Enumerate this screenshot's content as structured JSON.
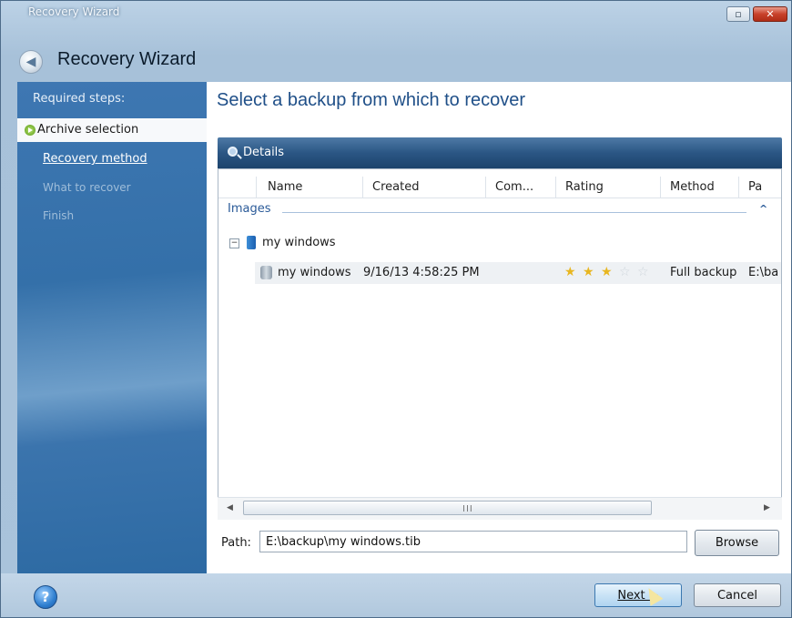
{
  "window": {
    "title": "Recovery Wizard",
    "controls": {
      "maximize": "▫",
      "close": "✕"
    }
  },
  "header": {
    "title": "Recovery Wizard",
    "back": "◀"
  },
  "sidebar": {
    "required_label": "Required steps:",
    "steps": [
      {
        "label": "Archive selection",
        "state": "active"
      },
      {
        "label": "Recovery method",
        "state": "link"
      },
      {
        "label": "What to recover",
        "state": "disabled"
      },
      {
        "label": "Finish",
        "state": "disabled"
      }
    ]
  },
  "main": {
    "title": "Select a backup from which to recover",
    "details_label": "Details",
    "columns": [
      "Name",
      "Created",
      "Com...",
      "Rating",
      "Method",
      "Pa"
    ],
    "group": {
      "label": "Images",
      "collapse": "^"
    },
    "tree": {
      "toggle": "−",
      "label": "my windows"
    },
    "row": {
      "name": "my windows",
      "created": "9/16/13 4:58:25 PM",
      "comment": "",
      "rating": 3,
      "rating_max": 5,
      "method": "Full backup",
      "path": "E:\\ba"
    },
    "scroll": {
      "left": "◀",
      "right": "▶",
      "grip": "III"
    },
    "path": {
      "label": "Path:",
      "value": "E:\\backup\\my windows.tib",
      "browse": "Browse"
    }
  },
  "footer": {
    "help": "?",
    "next": "Next >",
    "cancel": "Cancel"
  },
  "colors": {
    "accent": "#1f4f88",
    "sidebar": "#3470a9",
    "link_group": "#2a5a98",
    "star": "#e8b620"
  }
}
